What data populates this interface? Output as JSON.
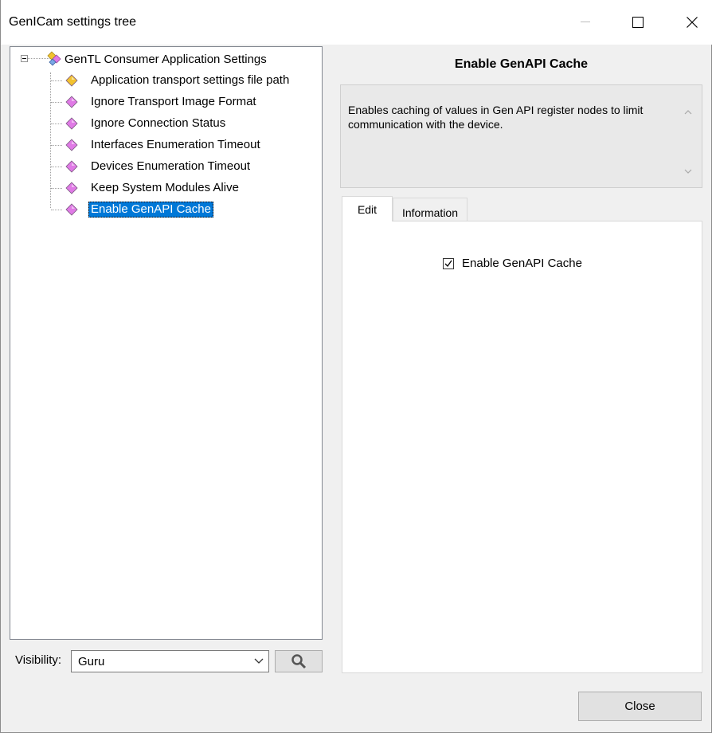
{
  "window": {
    "title": "GenICam settings tree",
    "controls": {
      "minimize": "minimize-icon",
      "maximize": "maximize-icon",
      "close": "close-icon"
    }
  },
  "tree": {
    "root": {
      "label": "GenTL Consumer Application Settings",
      "icon": "category-icon",
      "expanded": true
    },
    "items": [
      {
        "label": "Application transport settings file path",
        "icon": "yellow-diamond-icon",
        "color": "#f2c230"
      },
      {
        "label": "Ignore Transport Image Format",
        "icon": "pink-diamond-icon",
        "color": "#e07ae6"
      },
      {
        "label": "Ignore Connection Status",
        "icon": "pink-diamond-icon",
        "color": "#e07ae6"
      },
      {
        "label": "Interfaces Enumeration Timeout",
        "icon": "pink-diamond-icon",
        "color": "#e07ae6"
      },
      {
        "label": "Devices Enumeration Timeout",
        "icon": "pink-diamond-icon",
        "color": "#e07ae6"
      },
      {
        "label": "Keep System Modules Alive",
        "icon": "pink-diamond-icon",
        "color": "#e07ae6"
      },
      {
        "label": "Enable GenAPI Cache",
        "icon": "pink-diamond-icon",
        "color": "#e07ae6",
        "selected": true
      }
    ]
  },
  "visibility": {
    "label": "Visibility:",
    "value": "Guru",
    "search_icon": "search-icon"
  },
  "details": {
    "heading": "Enable GenAPI Cache",
    "description": "Enables caching of values in Gen API register nodes to limit communication with the device.",
    "tabs": [
      {
        "label": "Edit",
        "active": true
      },
      {
        "label": "Information",
        "active": false
      }
    ],
    "checkbox": {
      "label": "Enable GenAPI Cache",
      "checked": true
    }
  },
  "footer": {
    "close_label": "Close"
  },
  "colors": {
    "selection": "#0078d7",
    "window_bg": "#f0f0f0"
  }
}
